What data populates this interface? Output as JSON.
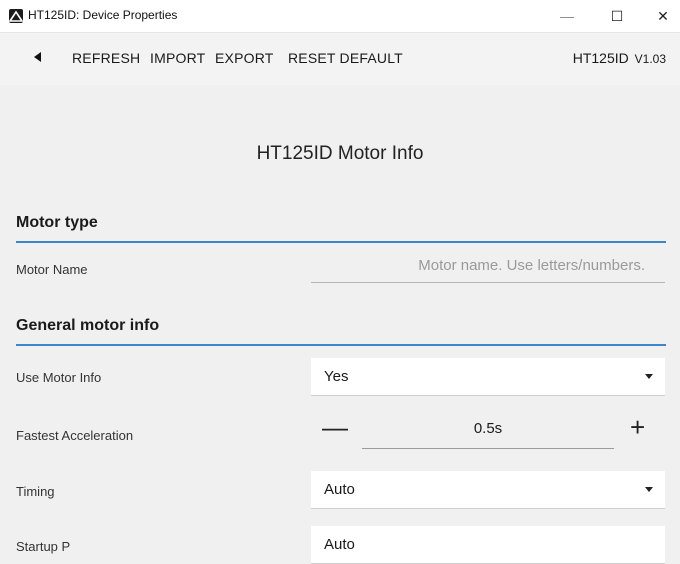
{
  "window": {
    "title": "HT125ID: Device Properties",
    "min_glyph": "—",
    "max_glyph": "☐",
    "close_glyph": "✕"
  },
  "toolbar": {
    "refresh_label": "REFRESH",
    "import_label": "IMPORT",
    "export_label": "EXPORT",
    "reset_label": "RESET DEFAULT",
    "device_label": "HT125ID",
    "version_label": "V1.03"
  },
  "page": {
    "title": "HT125ID Motor Info"
  },
  "sections": {
    "motor_type": {
      "heading": "Motor type",
      "motor_name_label": "Motor Name",
      "motor_name_value": "",
      "motor_name_placeholder": "Motor name. Use letters/numbers."
    },
    "general": {
      "heading": "General motor info",
      "use_motor_info_label": "Use Motor Info",
      "use_motor_info_value": "Yes",
      "fastest_accel_label": "Fastest Acceleration",
      "fastest_accel_value": "0.5s",
      "minus_glyph": "—",
      "plus_glyph": "+",
      "timing_label": "Timing",
      "timing_value": "Auto",
      "partial_label": "Startup P",
      "partial_value": "Auto"
    }
  },
  "colors": {
    "accent": "#3a86c8",
    "background": "#f0f0f0"
  },
  "icons": {
    "app": "app-logo-icon",
    "back": "back-arrow-icon",
    "dropdown": "caret-down-icon"
  }
}
